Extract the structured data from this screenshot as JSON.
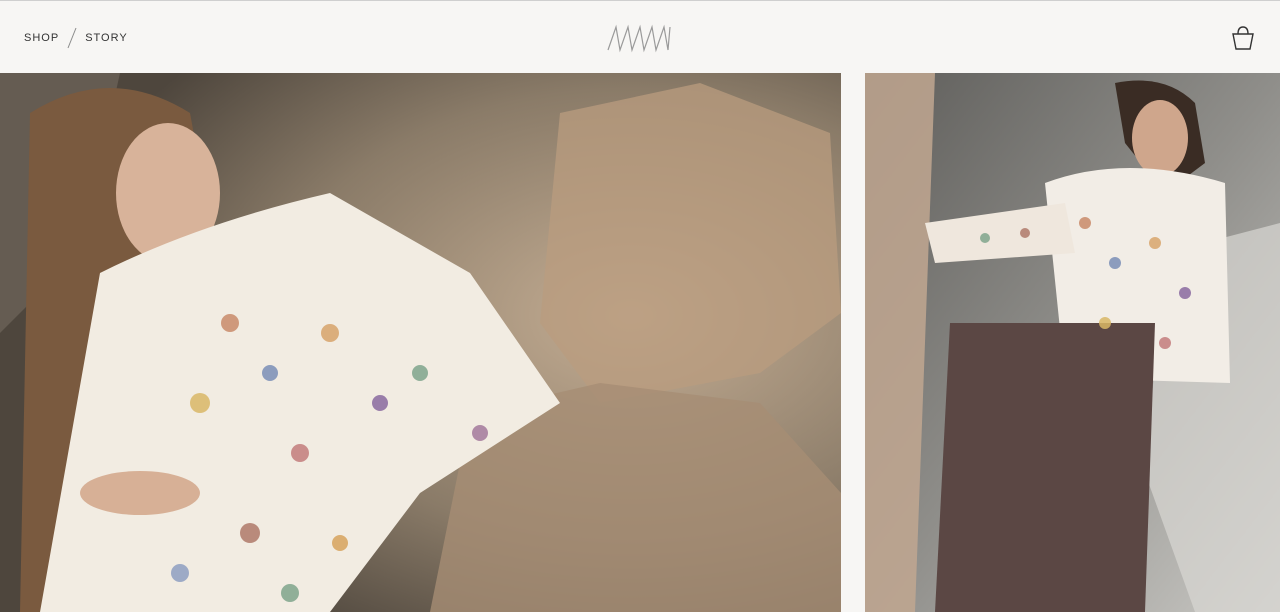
{
  "nav": {
    "items": [
      {
        "label": "SHOP"
      },
      {
        "label": "STORY"
      }
    ]
  },
  "logo": {
    "name": "brand-logo-mark"
  },
  "cart": {
    "icon": "basket-icon"
  },
  "photos": [
    {
      "alt": "model-seated-on-rocks"
    },
    {
      "alt": "model-standing-by-rock"
    }
  ],
  "colors": {
    "header_bg": "#f7f6f4",
    "text": "#333333",
    "logo_stroke": "#9a9a9a"
  }
}
